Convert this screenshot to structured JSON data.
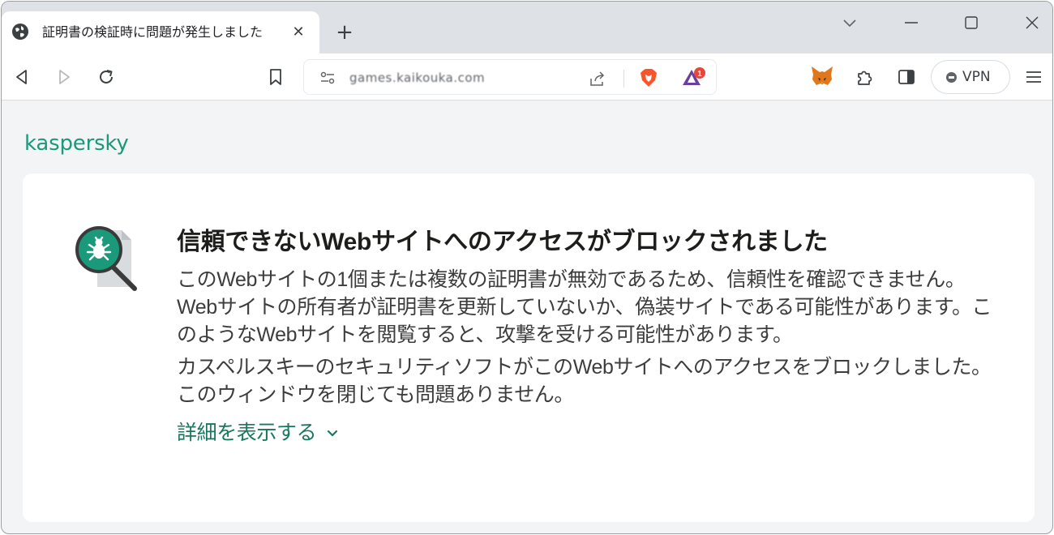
{
  "browser": {
    "tab": {
      "title": "証明書の検証時に問題が発生しました",
      "close_glyph": "✕",
      "favicon": "globe-icon"
    },
    "new_tab_glyph": "+",
    "address": {
      "url": "games.kaikouka.com"
    },
    "extensions": {
      "brave_rewards_badge": "1"
    },
    "vpn": {
      "label": "VPN"
    }
  },
  "page": {
    "logo_text": "kaspersky",
    "heading": "信頼できないWebサイトへのアクセスがブロックされました",
    "paragraph1": "このWebサイトの1個または複数の証明書が無効であるため、信頼性を確認できません。Webサイトの所有者が証明書を更新していないか、偽装サイトである可能性があります。このようなWebサイトを閲覧すると、攻撃を受ける可能性があります。",
    "paragraph2": "カスペルスキーのセキュリティソフトがこのWebサイトへのアクセスをブロックしました。このウィンドウを閉じても問題ありません。",
    "details_link": "詳細を表示する"
  },
  "colors": {
    "brand_green": "#1a9a7a",
    "link_green": "#197760",
    "tabstrip_bg": "#dee1e6",
    "page_bg": "#f3f4f6"
  }
}
